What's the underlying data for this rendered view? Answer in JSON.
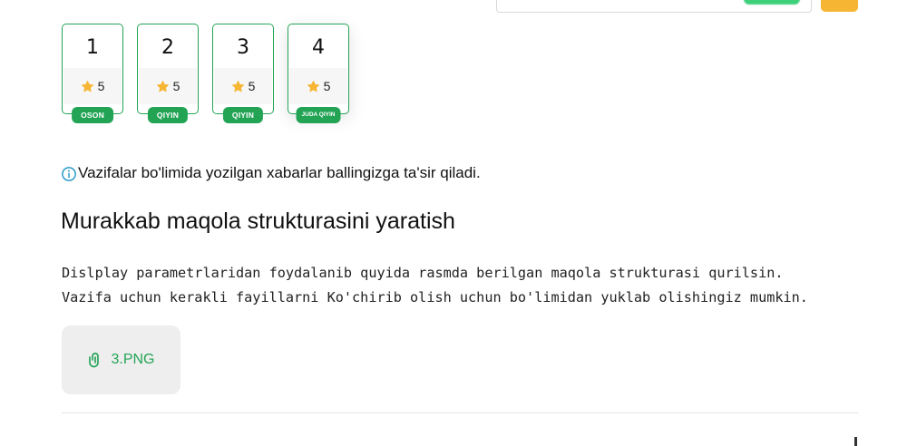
{
  "colors": {
    "accent_green": "#23a455",
    "star_orange": "#f6b533",
    "info_blue": "#2a9ac8"
  },
  "cards": [
    {
      "number": "1",
      "rating": "5",
      "difficulty": "OSON"
    },
    {
      "number": "2",
      "rating": "5",
      "difficulty": "QIYIN"
    },
    {
      "number": "3",
      "rating": "5",
      "difficulty": "QIYIN"
    },
    {
      "number": "4",
      "rating": "5",
      "difficulty": "JUDA QIYIN"
    }
  ],
  "info": {
    "icon": "info-circle-icon",
    "text": "Vazifalar bo'limida yozilgan xabarlar ballingizga ta'sir qiladi."
  },
  "task": {
    "title": "Murakkab maqola strukturasini yaratish",
    "description_line1": "Dislplay parametrlaridan foydalanib quyida rasmda berilgan maqola strukturasi qurilsin.",
    "description_line2": "Vazifa uchun kerakli fayillarni Ko'chirib olish uchun bo'limidan yuklab olishingiz mumkin."
  },
  "attachment": {
    "icon": "paperclip-icon",
    "filename": "3.PNG"
  }
}
